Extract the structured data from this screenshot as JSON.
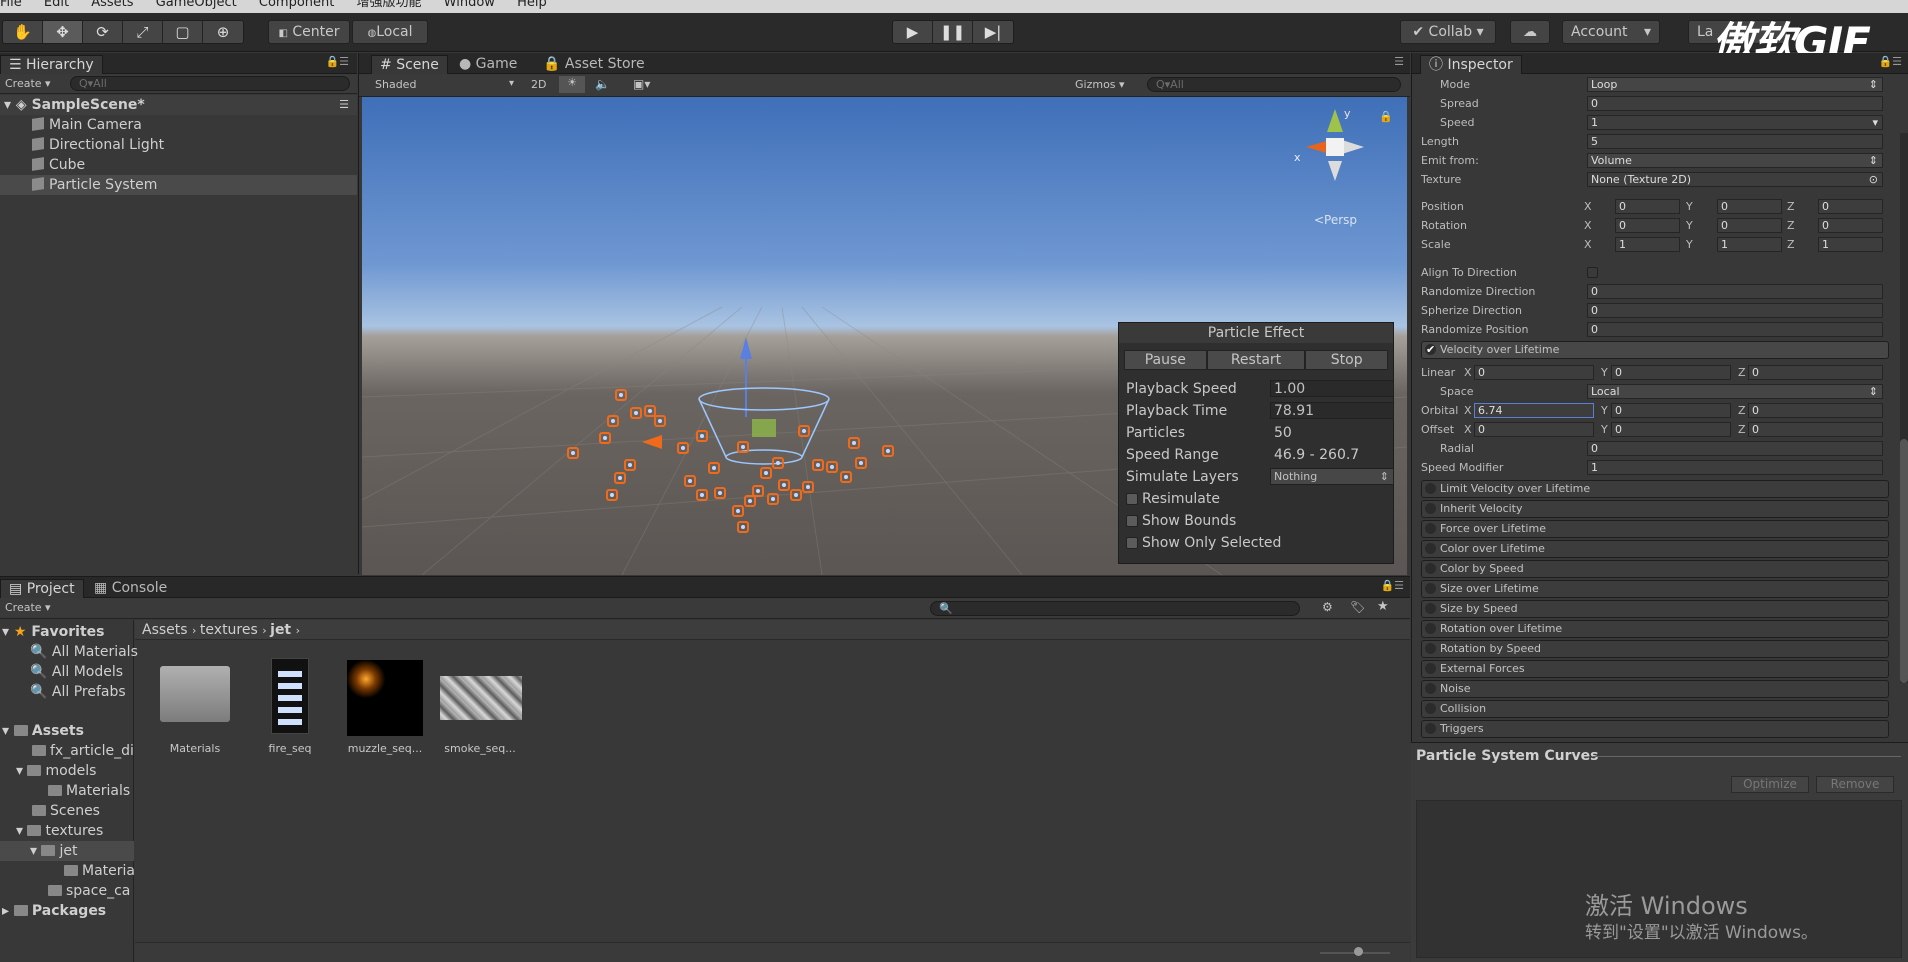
{
  "menubar": {
    "items": [
      "File",
      "Edit",
      "Assets",
      "GameObject",
      "Component",
      "增强版功能",
      "Window",
      "Help"
    ]
  },
  "toolbar": {
    "pivot_label": "Center",
    "space_label": "Local",
    "collab_label": "Collab",
    "account_label": "Account",
    "layers_label": "La",
    "watermark": "傲软GIF"
  },
  "hierarchy": {
    "tab": "Hierarchy",
    "create": "Create",
    "search_placeholder": "Q▾All",
    "scene": "SampleScene*",
    "items": [
      "Main Camera",
      "Directional Light",
      "Cube",
      "Particle System"
    ]
  },
  "scene": {
    "tabs": [
      "Scene",
      "Game",
      "Asset Store"
    ],
    "shading": "Shaded",
    "mode_2d": "2D",
    "gizmos": "Gizmos",
    "search_placeholder": "Q▾All",
    "persp": "<Persp",
    "axis_y": "y",
    "axis_x": "x"
  },
  "particle_effect": {
    "title": "Particle Effect",
    "buttons": [
      "Pause",
      "Restart",
      "Stop"
    ],
    "playback_speed_label": "Playback Speed",
    "playback_speed": "1.00",
    "playback_time_label": "Playback Time",
    "playback_time": "78.91",
    "particles_label": "Particles",
    "particles": "50",
    "speed_range_label": "Speed Range",
    "speed_range": "46.9 - 260.7",
    "simulate_layers_label": "Simulate Layers",
    "simulate_layers": "Nothing",
    "resimulate": "Resimulate",
    "show_bounds": "Show Bounds",
    "show_only_selected": "Show Only Selected"
  },
  "inspector": {
    "tab": "Inspector",
    "mode_label": "Mode",
    "mode": "Loop",
    "spread_label": "Spread",
    "spread": "0",
    "speed_label": "Speed",
    "speed": "1",
    "length_label": "Length",
    "length": "5",
    "emit_label": "Emit from:",
    "emit": "Volume",
    "texture_label": "Texture",
    "texture": "None (Texture 2D)",
    "position_label": "Position",
    "rotation_label": "Rotation",
    "scale_label": "Scale",
    "axis": {
      "x": "X",
      "y": "Y",
      "z": "Z"
    },
    "position": [
      "0",
      "0",
      "0"
    ],
    "rotation": [
      "0",
      "0",
      "0"
    ],
    "scale": [
      "1",
      "1",
      "1"
    ],
    "align_label": "Align To Direction",
    "rand_dir_label": "Randomize Direction",
    "rand_dir": "0",
    "spher_label": "Spherize Direction",
    "spher": "0",
    "rand_pos_label": "Randomize Position",
    "rand_pos": "0",
    "vol_title": "Velocity over Lifetime",
    "linear_label": "Linear",
    "linear": [
      "0",
      "0",
      "0"
    ],
    "space_label": "Space",
    "space": "Local",
    "orbital_label": "Orbital",
    "orbital": [
      "6.74",
      "0",
      "0"
    ],
    "offset_label": "Offset",
    "offset": [
      "0",
      "0",
      "0"
    ],
    "radial_label": "Radial",
    "radial": "0",
    "speed_mod_label": "Speed Modifier",
    "speed_mod": "1",
    "modules": [
      "Limit Velocity over Lifetime",
      "Inherit Velocity",
      "Force over Lifetime",
      "Color over Lifetime",
      "Color by Speed",
      "Size over Lifetime",
      "Size by Speed",
      "Rotation over Lifetime",
      "Rotation by Speed",
      "External Forces",
      "Noise",
      "Collision",
      "Triggers"
    ],
    "curves_title": "Particle System Curves",
    "optimize": "Optimize",
    "remove": "Remove"
  },
  "project": {
    "tabs": [
      "Project",
      "Console"
    ],
    "create": "Create",
    "favorites": "Favorites",
    "fav_items": [
      "All Materials",
      "All Models",
      "All Prefabs"
    ],
    "assets_root": "Assets",
    "tree": [
      {
        "label": "fx_article_di",
        "indent": 1
      },
      {
        "label": "models",
        "indent": 1
      },
      {
        "label": "Materials",
        "indent": 2
      },
      {
        "label": "Scenes",
        "indent": 1
      },
      {
        "label": "textures",
        "indent": 1
      },
      {
        "label": "jet",
        "indent": 2
      },
      {
        "label": "Materia",
        "indent": 3
      },
      {
        "label": "space_ca",
        "indent": 1
      }
    ],
    "packages": "Packages",
    "breadcrumb": [
      "Assets",
      "textures",
      "jet"
    ],
    "assets": [
      "Materials",
      "fire_seq",
      "muzzle_seq...",
      "smoke_seq..."
    ]
  },
  "os_watermark": {
    "line1": "激活 Windows",
    "line2": "转到\"设置\"以激活 Windows。"
  }
}
